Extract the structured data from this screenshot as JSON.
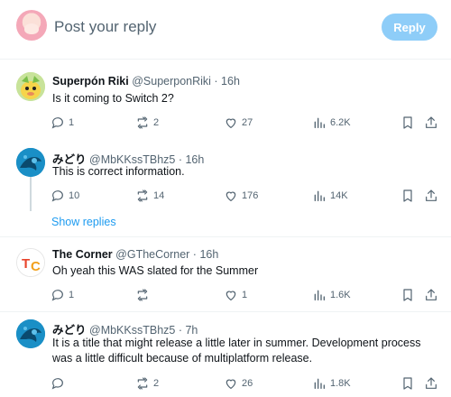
{
  "compose": {
    "placeholder": "Post your reply",
    "reply_label": "Reply"
  },
  "posts": [
    {
      "name": "Superpón Riki",
      "handle": "@SuperponRiki · 16h",
      "text": "Is it coming to Switch 2?",
      "replies": "1",
      "reposts": "2",
      "likes": "27",
      "views": "6.2K"
    },
    {
      "name": "みどり",
      "handle": "@MbKKssTBhz5 · 16h",
      "text": "This is correct information.",
      "replies": "10",
      "reposts": "14",
      "likes": "176",
      "views": "14K"
    },
    {
      "name": "The Corner",
      "handle": "@GTheCorner · 16h",
      "text": "Oh yeah this WAS slated for the Summer",
      "replies": "1",
      "reposts": "",
      "likes": "1",
      "views": "1.6K"
    },
    {
      "name": "みどり",
      "handle": "@MbKKssTBhz5 · 7h",
      "text": "It is a title that might release a little later in summer. Development process was a little difficult because of multiplatform release.",
      "replies": "",
      "reposts": "2",
      "likes": "26",
      "views": "1.8K"
    }
  ],
  "show_replies": "Show replies",
  "icons": [
    "reply-icon",
    "repost-icon",
    "like-icon",
    "views-icon",
    "bookmark-icon",
    "share-icon"
  ],
  "colors": {
    "accent": "#1d9bf0",
    "reply_button_disabled": "#8ecdf8",
    "secondary_text": "#536471"
  }
}
